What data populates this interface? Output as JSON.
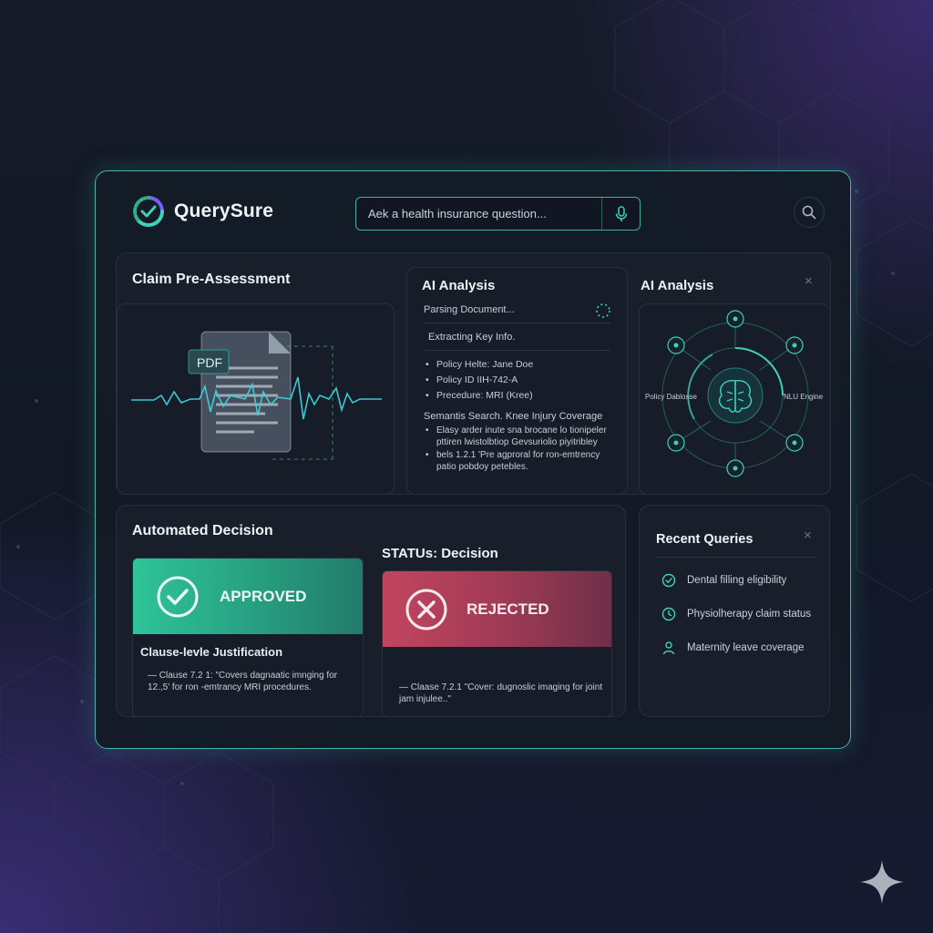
{
  "app": {
    "name": "QuerySure"
  },
  "search": {
    "placeholder": "Aek a health insurance question..."
  },
  "icons": {
    "logo": "querysure-check-icon",
    "mic": "microphone-icon",
    "search": "search-icon",
    "brain": "brain-icon",
    "approved": "check-circle-icon",
    "rejected": "x-circle-icon",
    "sparkle": "sparkle-icon"
  },
  "colors": {
    "accent": "#3fd1b8",
    "approved": "#2fae8a",
    "rejected": "#c2455f",
    "border": "#3fb6a8"
  },
  "claim": {
    "title": "Claim Pre-Assessment",
    "badge": "PDF"
  },
  "analysis": {
    "title": "AI Analysis",
    "parsing": "Parsing Document...",
    "extracting": "Extracting Key Info.",
    "fields": [
      "Policy Helte: Jane Doe",
      "Policy ID IIH-742-A",
      "Precedure: MRI (Kree)"
    ],
    "semantic_heading": "Semantis Search. Knee Injury Coverage",
    "semantic_items": [
      "Elasy arder inute sna brocane lo tionipeler pttiren lwistolbtiop Gevsuriolio piyitribley",
      "bels 1.2.1 'Pre agproral for ron-emtrency patio pobdoy petebles."
    ]
  },
  "graph": {
    "title": "AI Analysis",
    "close": "×",
    "left_label": "Policy Dablosse",
    "right_label": "NLU Engine"
  },
  "decision": {
    "title": "Automated Decision",
    "status_title": "STATUs: Decision",
    "approved": {
      "label": "APPROVED",
      "justification_title": "Clause-levle Justification",
      "justification_text": "— Clause 7.2 1: \"Covers dagnaatic imnging for 12.,5' for ron -emtrancy MRI procedures."
    },
    "rejected": {
      "label": "REJECTED",
      "justification_text": "— Claase 7.2.1 \"Cover: dugnoslic imaging for joint jam injulee..\""
    }
  },
  "recent": {
    "title": "Recent Queries",
    "close": "×",
    "items": [
      {
        "icon": "check-circle-icon",
        "label": "Dental filling eligibility"
      },
      {
        "icon": "clock-icon",
        "label": "Physiolherapy claim status"
      },
      {
        "icon": "person-icon",
        "label": "Maternity leave coverage"
      }
    ]
  }
}
